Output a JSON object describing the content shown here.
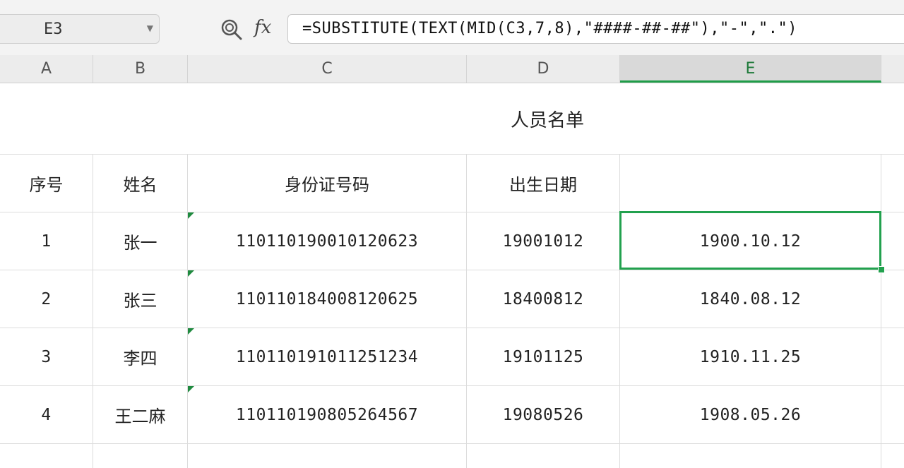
{
  "name_box": {
    "value": "E3"
  },
  "formula_bar": {
    "zoom_icon": "zoom-search-icon",
    "fx_label": "fx",
    "formula": "=SUBSTITUTE(TEXT(MID(C3,7,8),\"####-##-##\"),\"-\",\".\")"
  },
  "columns": [
    "A",
    "B",
    "C",
    "D",
    "E"
  ],
  "active_column": "E",
  "sheet": {
    "title": "人员名单",
    "headers": [
      "序号",
      "姓名",
      "身份证号码",
      "出生日期",
      ""
    ],
    "rows": [
      {
        "no": "1",
        "name": "张一",
        "id": "110110190010120623",
        "birth": "19001012",
        "formatted": "1900.10.12"
      },
      {
        "no": "2",
        "name": "张三",
        "id": "110110184008120625",
        "birth": "18400812",
        "formatted": "1840.08.12"
      },
      {
        "no": "3",
        "name": "李四",
        "id": "110110191011251234",
        "birth": "19101125",
        "formatted": "1910.11.25"
      },
      {
        "no": "4",
        "name": "王二麻",
        "id": "110110190805264567",
        "birth": "19080526",
        "formatted": "1908.05.26"
      }
    ]
  },
  "colors": {
    "accent": "#22a14e",
    "header_bg": "#ececec"
  }
}
